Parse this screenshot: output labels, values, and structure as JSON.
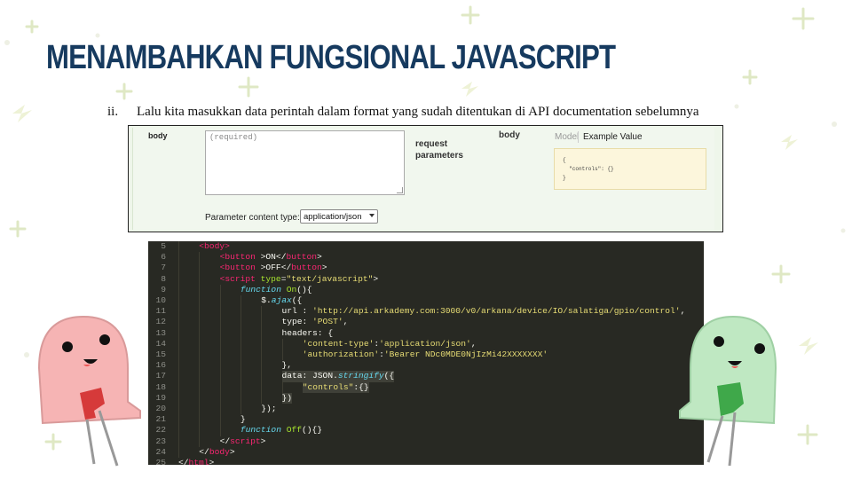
{
  "slide": {
    "title": "MENAMBAHKAN FUNGSIONAL JAVASCRIPT",
    "bullet_numeral": "ii.",
    "bullet_text": "Lalu kita masukkan data perintah dalam format yang sudah ditentukan di API documentation sebelumnya"
  },
  "api_panel": {
    "param_name": "body",
    "textarea_placeholder": "(required)",
    "description": "request parameters",
    "param_type": "body",
    "tab_model": "Model",
    "tab_example": "Example Value",
    "example_value": "{\n  \"controls\": {}\n}",
    "content_type_label": "Parameter content type:",
    "content_type_value": "application/json"
  },
  "code_editor": {
    "lines": [
      {
        "n": "5",
        "indent": 1,
        "tokens": [
          [
            "t-tag",
            "<body>"
          ]
        ]
      },
      {
        "n": "6",
        "indent": 2,
        "tokens": [
          [
            "t-tag",
            "<button"
          ],
          [
            "t-pl",
            " >ON</"
          ],
          [
            "t-tag",
            "button"
          ],
          [
            "t-pl",
            ">"
          ]
        ]
      },
      {
        "n": "7",
        "indent": 2,
        "tokens": [
          [
            "t-tag",
            "<button"
          ],
          [
            "t-pl",
            " >OFF</"
          ],
          [
            "t-tag",
            "button"
          ],
          [
            "t-pl",
            ">"
          ]
        ]
      },
      {
        "n": "8",
        "indent": 2,
        "tokens": [
          [
            "t-tag",
            "<script"
          ],
          [
            "t-attr",
            " type"
          ],
          [
            "t-pl",
            "="
          ],
          [
            "t-str",
            "\"text/javascript\""
          ],
          [
            "t-pl",
            ">"
          ]
        ]
      },
      {
        "n": "9",
        "indent": 3,
        "tokens": [
          [
            "t-kw",
            "function"
          ],
          [
            "t-fn",
            " On"
          ],
          [
            "t-pl",
            "(){"
          ]
        ]
      },
      {
        "n": "10",
        "indent": 4,
        "tokens": [
          [
            "t-pl",
            "$."
          ],
          [
            "t-kw",
            "ajax"
          ],
          [
            "t-pl",
            "({"
          ]
        ]
      },
      {
        "n": "11",
        "indent": 5,
        "tokens": [
          [
            "t-pl",
            "url : "
          ],
          [
            "t-str",
            "'http://api.arkademy.com:3000/v0/arkana/device/IO/salatiga/gpio/control'"
          ],
          [
            "t-pl",
            ","
          ]
        ]
      },
      {
        "n": "12",
        "indent": 5,
        "tokens": [
          [
            "t-pl",
            "type: "
          ],
          [
            "t-str",
            "'POST'"
          ],
          [
            "t-pl",
            ","
          ]
        ]
      },
      {
        "n": "13",
        "indent": 5,
        "tokens": [
          [
            "t-pl",
            "headers: {"
          ]
        ]
      },
      {
        "n": "14",
        "indent": 6,
        "tokens": [
          [
            "t-str",
            "'content-type'"
          ],
          [
            "t-pl",
            ":"
          ],
          [
            "t-str",
            "'application/json'"
          ],
          [
            "t-pl",
            ","
          ]
        ]
      },
      {
        "n": "15",
        "indent": 6,
        "tokens": [
          [
            "t-str",
            "'authorization'"
          ],
          [
            "t-pl",
            ":"
          ],
          [
            "t-str",
            "'Bearer NDc0MDE0NjIzMi42XXXXXXX'"
          ]
        ]
      },
      {
        "n": "16",
        "indent": 5,
        "tokens": [
          [
            "t-pl",
            "},"
          ]
        ]
      },
      {
        "n": "17",
        "indent": 5,
        "tokens": [
          [
            "t-pl",
            "data: JSON."
          ],
          [
            "t-kw",
            "stringify"
          ],
          [
            "t-pl",
            "({"
          ]
        ]
      },
      {
        "n": "18",
        "indent": 6,
        "tokens": [
          [
            "t-str",
            "\"controls\""
          ],
          [
            "t-pl",
            ":{}"
          ]
        ]
      },
      {
        "n": "19",
        "indent": 5,
        "tokens": [
          [
            "t-pl",
            "})"
          ]
        ]
      },
      {
        "n": "20",
        "indent": 4,
        "tokens": [
          [
            "t-pl",
            "});"
          ]
        ]
      },
      {
        "n": "21",
        "indent": 3,
        "tokens": [
          [
            "t-pl",
            "}"
          ]
        ]
      },
      {
        "n": "22",
        "indent": 3,
        "tokens": [
          [
            "t-kw",
            "function"
          ],
          [
            "t-fn",
            " Off"
          ],
          [
            "t-pl",
            "(){}"
          ]
        ]
      },
      {
        "n": "23",
        "indent": 2,
        "tokens": [
          [
            "t-pl",
            "</"
          ],
          [
            "t-tag",
            "script"
          ],
          [
            "t-pl",
            ">"
          ]
        ]
      },
      {
        "n": "24",
        "indent": 1,
        "tokens": [
          [
            "t-pl",
            "</"
          ],
          [
            "t-tag",
            "body"
          ],
          [
            "t-pl",
            ">"
          ]
        ]
      },
      {
        "n": "25",
        "indent": 0,
        "tokens": [
          [
            "t-pl",
            "</"
          ],
          [
            "t-tag",
            "html"
          ],
          [
            "t-pl",
            ">"
          ]
        ]
      }
    ],
    "highlighted_lines": [
      "17",
      "18",
      "19"
    ]
  },
  "colors": {
    "title": "#163a5f",
    "editor_bg": "#282923",
    "panel_bg": "#f1f7ee",
    "sample_bg": "#fcf6dc",
    "mascot_red": "#f6b4b4",
    "mascot_green": "#bfe8c2"
  }
}
